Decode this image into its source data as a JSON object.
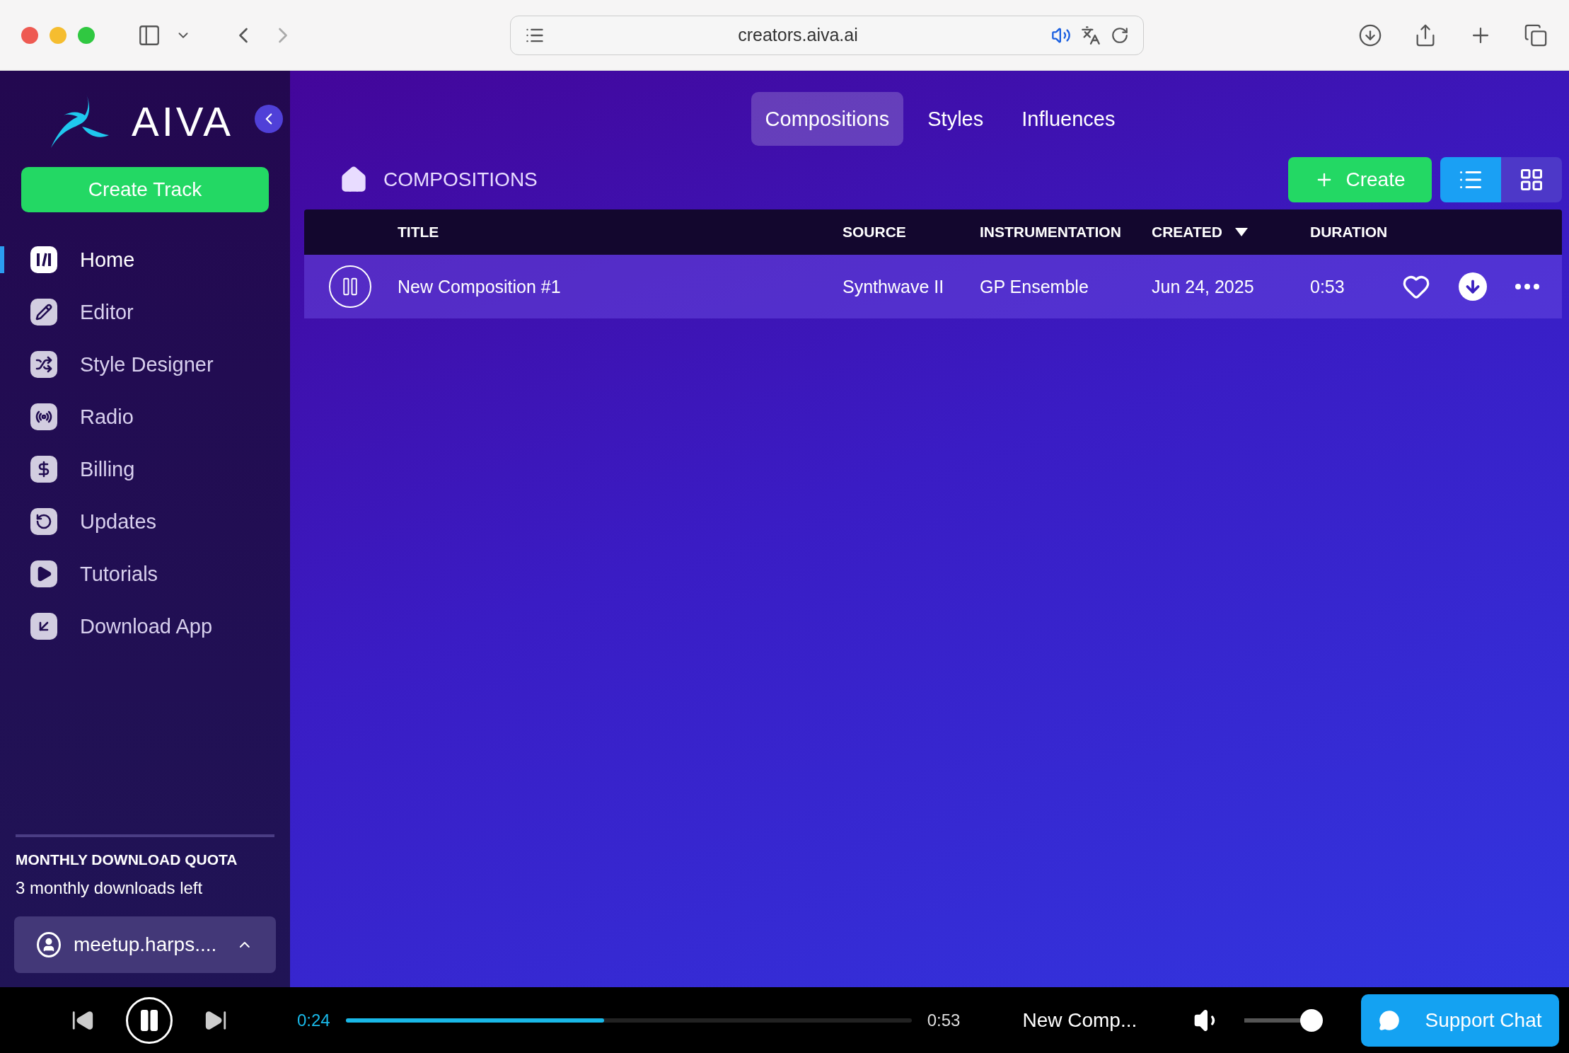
{
  "browser": {
    "url": "creators.aiva.ai"
  },
  "sidebar": {
    "logo": "AIVA",
    "create_button": "Create Track",
    "items": [
      {
        "kind": "home",
        "label": "Home",
        "selected": true
      },
      {
        "kind": "editor",
        "label": "Editor",
        "selected": false
      },
      {
        "kind": "style",
        "label": "Style Designer",
        "selected": false
      },
      {
        "kind": "radio",
        "label": "Radio",
        "selected": false
      },
      {
        "kind": "billing",
        "label": "Billing",
        "selected": false
      },
      {
        "kind": "updates",
        "label": "Updates",
        "selected": false
      },
      {
        "kind": "tutorials",
        "label": "Tutorials",
        "selected": false
      },
      {
        "kind": "download",
        "label": "Download App",
        "selected": false
      }
    ],
    "quota": {
      "title": "MONTHLY DOWNLOAD QUOTA",
      "text": "3 monthly downloads left"
    },
    "account": "meetup.harps...."
  },
  "tabs": [
    {
      "label": "Compositions",
      "selected": true
    },
    {
      "label": "Styles",
      "selected": false
    },
    {
      "label": "Influences",
      "selected": false
    }
  ],
  "breadcrumb": "COMPOSITIONS",
  "create_button": "Create",
  "views": [
    {
      "kind": "list",
      "selected": true
    },
    {
      "kind": "grid",
      "selected": false
    }
  ],
  "table": {
    "columns": [
      {
        "label": "TITLE",
        "sorted": false
      },
      {
        "label": "SOURCE",
        "sorted": false
      },
      {
        "label": "INSTRUMENTATION",
        "sorted": false
      },
      {
        "label": "CREATED",
        "sorted": true
      },
      {
        "label": "DURATION",
        "sorted": false
      }
    ],
    "rows": [
      {
        "title": "New Composition #1",
        "source": "Synthwave II",
        "instrumentation": "GP Ensemble",
        "created": "Jun 24, 2025",
        "duration": "0:53",
        "playing": true,
        "favorite": false
      }
    ]
  },
  "player": {
    "playing": true,
    "elapsed": "0:24",
    "level": 0.457,
    "total": "0:53",
    "track": "New Comp...",
    "volume": {
      "level": 0.88
    },
    "support_button": "Support Chat"
  }
}
